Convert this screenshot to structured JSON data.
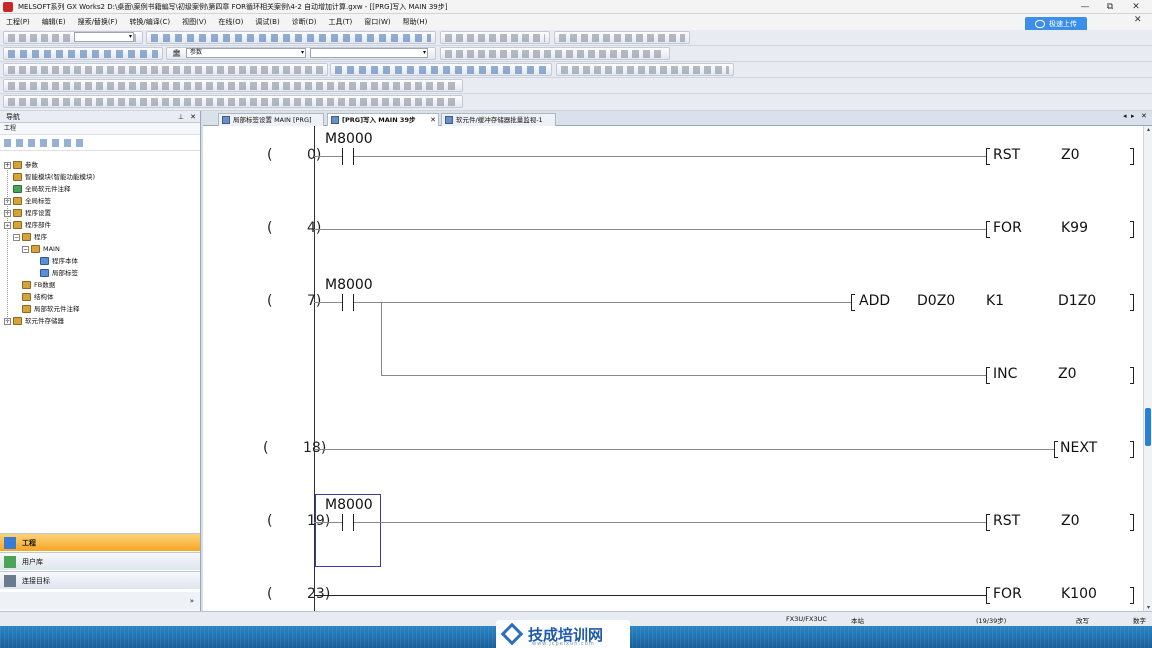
{
  "window": {
    "title": "MELSOFT系列 GX Works2 D:\\桌面\\案例书籍編写\\初级案例\\第四章 FOR循环相关案例\\4-2 自动增加计算.gxw - [[PRG]写入 MAIN 39步]",
    "controls": [
      "—",
      "⧉",
      "✕"
    ]
  },
  "menu": {
    "items": [
      "工程(P)",
      "编辑(E)",
      "搜索/替换(F)",
      "转换/编译(C)",
      "视图(V)",
      "在线(O)",
      "调试(B)",
      "诊断(D)",
      "工具(T)",
      "窗口(W)",
      "帮助(H)"
    ],
    "cloud_button": "极速上传",
    "close": "✕"
  },
  "toolbar": {
    "select1": "",
    "select2": "参数",
    "select2_icon": "🏛"
  },
  "navigation": {
    "title": "导航",
    "pin": "⊥",
    "close": "✕",
    "subtitle": "工程",
    "tree": [
      {
        "label": "参数",
        "exp": "+",
        "indent": 0
      },
      {
        "label": "智能模块(智能功能模块)",
        "exp": "",
        "indent": 0
      },
      {
        "label": "全局软元件注释",
        "exp": "",
        "indent": 0
      },
      {
        "label": "全局标签",
        "exp": "+",
        "indent": 0
      },
      {
        "label": "程序设置",
        "exp": "+",
        "indent": 0
      },
      {
        "label": "程序部件",
        "exp": "−",
        "indent": 0
      },
      {
        "label": "程序",
        "exp": "−",
        "indent": 1
      },
      {
        "label": "MAIN",
        "exp": "−",
        "indent": 2
      },
      {
        "label": "程序本体",
        "exp": "",
        "indent": 3
      },
      {
        "label": "局部标签",
        "exp": "",
        "indent": 3
      },
      {
        "label": "FB数据",
        "exp": "",
        "indent": 1
      },
      {
        "label": "结构体",
        "exp": "",
        "indent": 1
      },
      {
        "label": "局部软元件注释",
        "exp": "",
        "indent": 1
      },
      {
        "label": "软元件存储器",
        "exp": "+",
        "indent": 0
      }
    ],
    "bottom_tabs": [
      "工程",
      "用户库",
      "连接目标"
    ],
    "more": "»"
  },
  "tabs": [
    {
      "label": "局部标签设置 MAIN [PRG]",
      "active": false
    },
    {
      "label": "[PRG]写入 MAIN 39步",
      "active": true
    },
    {
      "label": "软元件/缓冲存储器批量监视-1",
      "active": false
    }
  ],
  "tab_nav": [
    "◂",
    "▸",
    "✕"
  ],
  "ladder": {
    "rungs": [
      {
        "step": "0",
        "contact": "M8000",
        "instruction": [
          "RST",
          "Z0"
        ]
      },
      {
        "step": "4",
        "contact": "",
        "instruction": [
          "FOR",
          "K99"
        ]
      },
      {
        "step": "7",
        "contact": "M8000",
        "instruction": [
          "ADD",
          "D0Z0",
          "K1",
          "D1Z0"
        ],
        "branch_instruction": [
          "INC",
          "Z0"
        ]
      },
      {
        "step": "18",
        "contact": "",
        "instruction": [
          "NEXT"
        ]
      },
      {
        "step": "19",
        "contact": "M8000",
        "instruction": [
          "RST",
          "Z0"
        ]
      },
      {
        "step": "23",
        "contact": "",
        "instruction": [
          "FOR",
          "K100"
        ]
      }
    ]
  },
  "status": {
    "plc": "FX3U/FX3UC",
    "station": "本站",
    "steps": "(19/39步)",
    "mode": "改写",
    "numlock": "数字"
  },
  "branding": {
    "name": "技成培训网",
    "url": "www.jcpeixun.com"
  },
  "colors": {
    "accent_tab": "#f5a623",
    "scroll_thumb": "#2a7fd6",
    "cloud": "#3b8fe8",
    "cursor": "#3c3c9e"
  }
}
